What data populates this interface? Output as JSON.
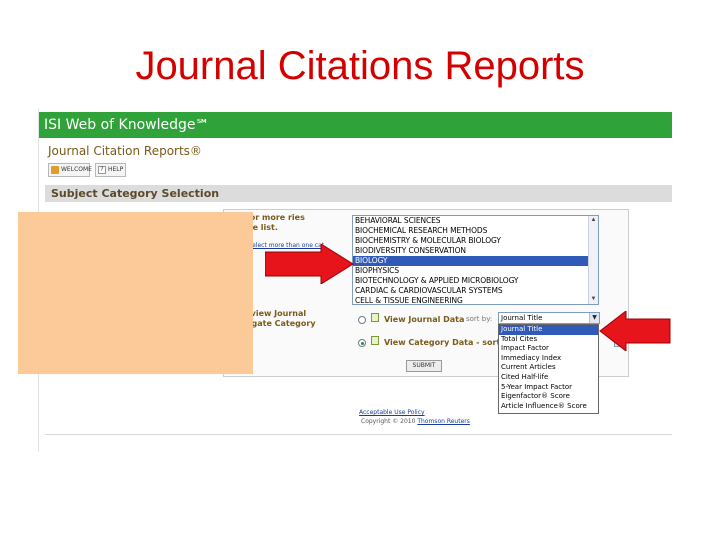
{
  "slide": {
    "title": "Journal Citations Reports"
  },
  "header": {
    "app_name": "ISI Web of Knowledge℠",
    "product": "Journal Citation Reports®"
  },
  "nav": {
    "welcome": "WELCOME",
    "help": "HELP"
  },
  "section": {
    "title": "Subject Category Selection"
  },
  "instructions": {
    "step1": "ct one or more ries from the list.",
    "step1_link": "select more than one cat",
    "step2": "lect to view Journal data regate Category data."
  },
  "category_list": {
    "options": [
      "BEHAVIORAL SCIENCES",
      "BIOCHEMICAL RESEARCH METHODS",
      "BIOCHEMISTRY & MOLECULAR BIOLOGY",
      "BIODIVERSITY CONSERVATION",
      "BIOLOGY",
      "BIOPHYSICS",
      "BIOTECHNOLOGY & APPLIED MICROBIOLOGY",
      "CARDIAC & CARDIOVASCULAR SYSTEMS",
      "CELL & TISSUE ENGINEERING"
    ],
    "selected": "BIOLOGY"
  },
  "view_options": {
    "journal_label": "View Journal Data",
    "category_label": "View Category Data - sort by",
    "sort_by_label": "sort by:",
    "selected_view": "category"
  },
  "sort_select": {
    "value": "Journal Title",
    "options": [
      "Journal Title",
      "Total Cites",
      "Impact Factor",
      "Immediacy Index",
      "Current Articles",
      "Cited Half-life",
      "5-Year Impact Factor",
      "Eigenfactor® Score",
      "Article Influence® Score"
    ],
    "highlighted": "Journal Title"
  },
  "submit": {
    "label": "SUBMIT"
  },
  "footer": {
    "link": "Acceptable Use Policy",
    "copyright_prefix": "Copyright © 2010",
    "copyright_link": "Thomson Reuters"
  },
  "colors": {
    "title_red": "#d40000",
    "isi_green": "#2fa33a",
    "overlay_peach": "#fcc998",
    "arrow_red": "#e8141c",
    "selection_blue": "#3159b7"
  }
}
